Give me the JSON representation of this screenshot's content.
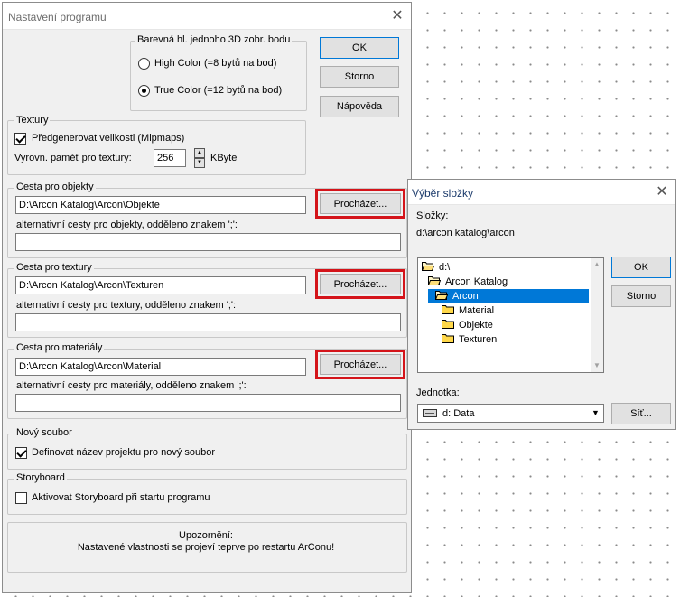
{
  "main_dialog": {
    "title": "Nastavení programu",
    "buttons": {
      "ok": "OK",
      "cancel": "Storno",
      "help": "Nápověda"
    },
    "color_depth": {
      "legend": "Barevná hl. jednoho 3D zobr. bodu",
      "options": [
        "High Color (=8 bytů na bod)",
        "True Color (=12 bytů na bod)"
      ],
      "selected_index": 1
    },
    "textures": {
      "legend": "Textury",
      "mipmaps_label": "Předgenerovat velikosti (Mipmaps)",
      "mipmaps_checked": true,
      "memory_label": "Vyrovn. paměť pro textury:",
      "memory_value": "256",
      "memory_unit": "KByte"
    },
    "objects_path": {
      "legend": "Cesta pro objekty",
      "value": "D:\\Arcon Katalog\\Arcon\\Objekte",
      "browse": "Procházet...",
      "alt_label": "alternativní cesty pro objekty, odděleno znakem ';':",
      "alt_value": ""
    },
    "textures_path": {
      "legend": "Cesta pro textury",
      "value": "D:\\Arcon Katalog\\Arcon\\Texturen",
      "browse": "Procházet...",
      "alt_label": "alternativní cesty pro textury, odděleno znakem ';':",
      "alt_value": ""
    },
    "materials_path": {
      "legend": "Cesta pro materiály",
      "value": "D:\\Arcon Katalog\\Arcon\\Material",
      "browse": "Procházet...",
      "alt_label": "alternativní cesty pro materiály, odděleno znakem ';':",
      "alt_value": ""
    },
    "new_file": {
      "legend": "Nový soubor",
      "define_label": "Definovat název projektu pro nový soubor",
      "define_checked": true
    },
    "storyboard": {
      "legend": "Storyboard",
      "activate_label": "Aktivovat Storyboard při startu programu",
      "activate_checked": false
    },
    "notice": {
      "line1": "Upozornění:",
      "line2": "Nastavené vlastnosti se projeví teprve po restartu ArConu!"
    }
  },
  "folder_dialog": {
    "title": "Výběr složky",
    "folders_label": "Složky:",
    "current_path": "d:\\arcon katalog\\arcon",
    "tree": [
      {
        "label": "d:\\",
        "level": 0,
        "open": true,
        "selected": false
      },
      {
        "label": "Arcon Katalog",
        "level": 1,
        "open": true,
        "selected": false
      },
      {
        "label": "Arcon",
        "level": 2,
        "open": true,
        "selected": true
      },
      {
        "label": "Material",
        "level": 3,
        "open": false,
        "selected": false
      },
      {
        "label": "Objekte",
        "level": 3,
        "open": false,
        "selected": false
      },
      {
        "label": "Texturen",
        "level": 3,
        "open": false,
        "selected": false
      }
    ],
    "drive_label": "Jednotka:",
    "drive_value": "d: Data",
    "buttons": {
      "ok": "OK",
      "cancel": "Storno",
      "network": "Síť..."
    }
  },
  "colors": {
    "highlight": "#d4141a",
    "selection": "#0078d7"
  }
}
